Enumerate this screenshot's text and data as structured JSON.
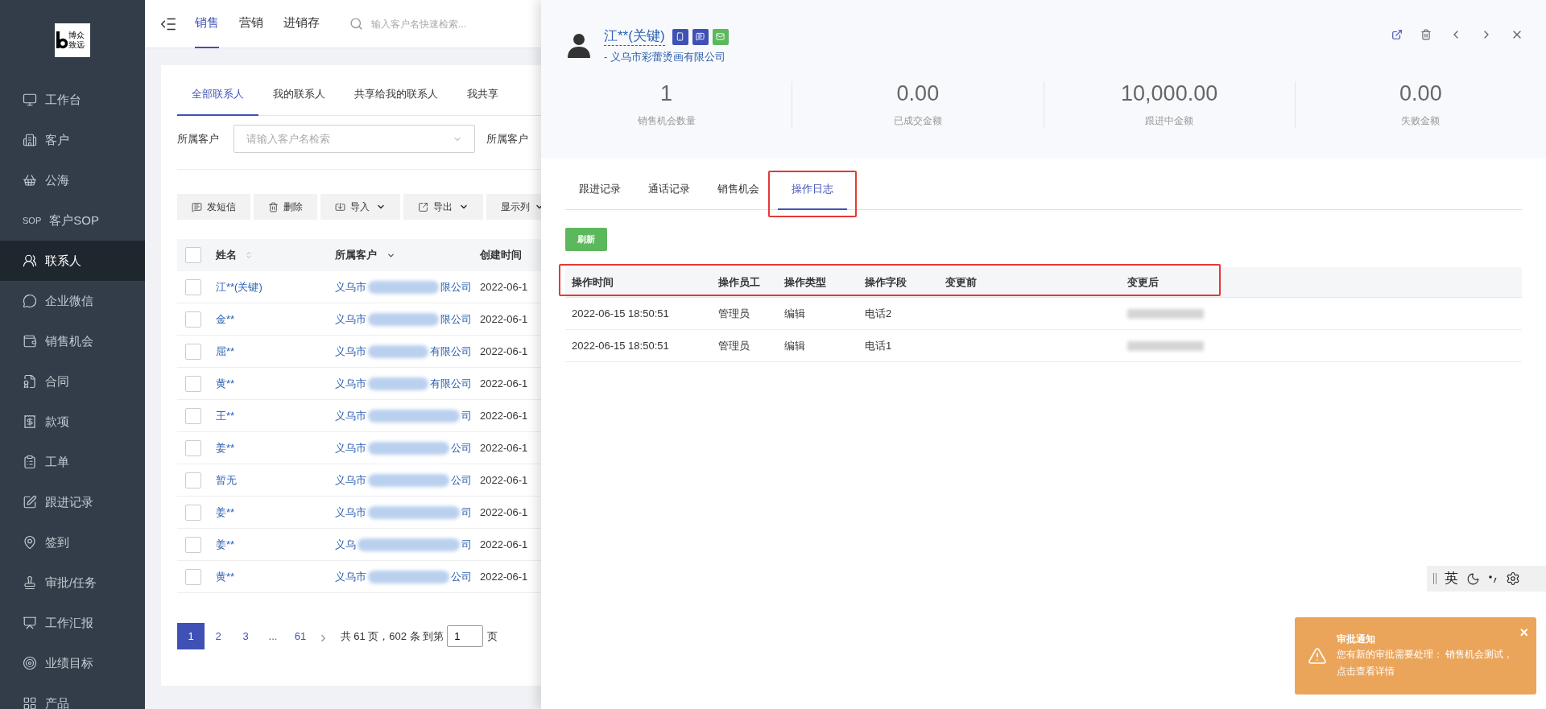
{
  "sidebar": {
    "logo_lines": [
      "博众",
      "致远"
    ],
    "items": [
      {
        "label": "工作台",
        "selected": false
      },
      {
        "label": "客户",
        "selected": false
      },
      {
        "label": "公海",
        "selected": false
      },
      {
        "label": "客户SOP",
        "icon_text": "SOP",
        "selected": false
      },
      {
        "label": "联系人",
        "selected": true
      },
      {
        "label": "企业微信",
        "selected": false
      },
      {
        "label": "销售机会",
        "selected": false
      },
      {
        "label": "合同",
        "selected": false
      },
      {
        "label": "款项",
        "selected": false
      },
      {
        "label": "工单",
        "selected": false
      },
      {
        "label": "跟进记录",
        "selected": false
      },
      {
        "label": "签到",
        "selected": false
      },
      {
        "label": "审批/任务",
        "selected": false
      },
      {
        "label": "工作汇报",
        "selected": false
      },
      {
        "label": "业绩目标",
        "selected": false
      },
      {
        "label": "产品",
        "selected": false
      }
    ]
  },
  "topbar": {
    "tabs": [
      {
        "label": "销售",
        "selected": true
      },
      {
        "label": "营销",
        "selected": false
      },
      {
        "label": "进销存",
        "selected": false
      }
    ],
    "search": {
      "placeholder": "输入客户名快速检索..."
    }
  },
  "contacts": {
    "tabs": [
      {
        "label": "全部联系人",
        "selected": true
      },
      {
        "label": "我的联系人",
        "selected": false
      },
      {
        "label": "共享给我的联系人",
        "selected": false
      },
      {
        "label": "我共享",
        "selected": false
      }
    ],
    "filter": {
      "label": "所属客户",
      "placeholder": "请输入客户名检索",
      "label_2": "所属客户"
    },
    "toolbar": [
      {
        "label": "发短信",
        "kind": "sms",
        "dropdown": false
      },
      {
        "label": "删除",
        "kind": "delete",
        "dropdown": false
      },
      {
        "label": "导入",
        "kind": "import",
        "dropdown": true
      },
      {
        "label": "导出",
        "kind": "export",
        "dropdown": true
      },
      {
        "label": "显示列",
        "kind": "plain",
        "dropdown": true
      }
    ],
    "table": {
      "select_all_checked": false,
      "columns": [
        "姓名",
        "所属客户",
        "创建时间"
      ],
      "rows": [
        {
          "checked": false,
          "name": "江**(关键)",
          "customer_start": "义乌市",
          "customer_end": "限公司",
          "created": "2022-06-1"
        },
        {
          "checked": false,
          "name": "金**",
          "customer_start": "义乌市",
          "customer_end": "限公司",
          "created": "2022-06-1"
        },
        {
          "checked": false,
          "name": "屈**",
          "customer_start": "义乌市",
          "customer_end": "有限公司",
          "created": "2022-06-1"
        },
        {
          "checked": false,
          "name": "黄**",
          "customer_start": "义乌市",
          "customer_end": "有限公司",
          "created": "2022-06-1"
        },
        {
          "checked": false,
          "name": "王**",
          "customer_start": "义乌市",
          "customer_end": "司",
          "created": "2022-06-1"
        },
        {
          "checked": false,
          "name": "姜**",
          "customer_start": "义乌市",
          "customer_end": "公司",
          "created": "2022-06-1"
        },
        {
          "checked": false,
          "name": "暂无",
          "customer_start": "义乌市",
          "customer_end": "公司",
          "created": "2022-06-1"
        },
        {
          "checked": false,
          "name": "姜**",
          "customer_start": "义乌市",
          "customer_end": "司",
          "created": "2022-06-1"
        },
        {
          "checked": false,
          "name": "姜**",
          "customer_start": "义乌",
          "customer_end": "司",
          "created": "2022-06-1"
        },
        {
          "checked": false,
          "name": "黄**",
          "customer_start": "义乌市",
          "customer_end": "公司",
          "created": "2022-06-1"
        }
      ]
    },
    "pagination": {
      "pages": [
        {
          "label": "1",
          "selected": true
        },
        {
          "label": "2",
          "selected": false
        },
        {
          "label": "3",
          "selected": false
        },
        {
          "label": "...",
          "selected": false
        },
        {
          "label": "61",
          "selected": false
        }
      ],
      "next": "›",
      "summary": "共 61 页，602 条 到第",
      "page_input": "1",
      "page_unit": "页"
    }
  },
  "drawer": {
    "name": "江**(关键)",
    "company": "- 义乌市彩蕾烫画有限公司",
    "stats": [
      {
        "value": "1",
        "label": "销售机会数量"
      },
      {
        "value": "0.00",
        "label": "已成交金额"
      },
      {
        "value": "10,000.00",
        "label": "跟进中金额"
      },
      {
        "value": "0.00",
        "label": "失败金额"
      }
    ],
    "tabs": [
      {
        "label": "跟进记录",
        "selected": false
      },
      {
        "label": "通话记录",
        "selected": false
      },
      {
        "label": "销售机会",
        "selected": false
      },
      {
        "label": "操作日志",
        "selected": true
      }
    ],
    "refresh_button": "刷新",
    "log_table": {
      "columns": [
        "操作时间",
        "操作员工",
        "操作类型",
        "操作字段",
        "变更前",
        "变更后"
      ],
      "rows": [
        {
          "time": "2022-06-15 18:50:51",
          "staff": "管理员",
          "type": "编辑",
          "field": "电话2"
        },
        {
          "time": "2022-06-15 18:50:51",
          "staff": "管理员",
          "type": "编辑",
          "field": "电话1"
        }
      ]
    }
  },
  "ime_toolbar": {
    "mode": "英"
  },
  "notification": {
    "title": "审批通知",
    "message": "您有新的审批需要处理： 销售机会测试，点击查看详情",
    "close": "×"
  }
}
